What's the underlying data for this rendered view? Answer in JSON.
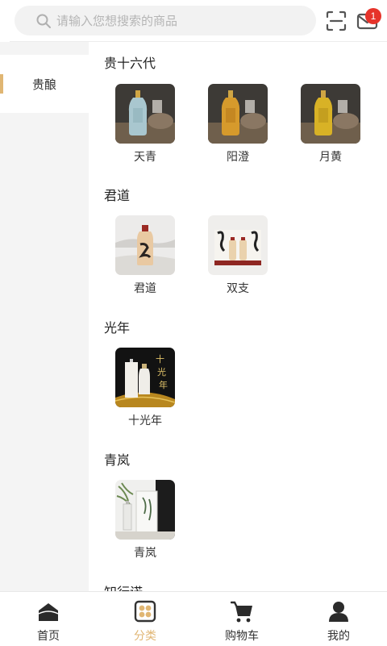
{
  "search": {
    "placeholder": "请输入您想搜索的商品"
  },
  "header": {
    "message_badge": "1"
  },
  "sidebar": {
    "items": [
      {
        "label": "贵酿",
        "active": true
      }
    ]
  },
  "sections": [
    {
      "title": "贵十六代",
      "products": [
        {
          "name": "天青"
        },
        {
          "name": "阳澄"
        },
        {
          "name": "月黄"
        }
      ]
    },
    {
      "title": "君道",
      "products": [
        {
          "name": "君道"
        },
        {
          "name": "双支"
        }
      ]
    },
    {
      "title": "光年",
      "products": [
        {
          "name": "十光年"
        }
      ]
    },
    {
      "title": "青岚",
      "products": [
        {
          "name": "青岚"
        }
      ]
    },
    {
      "title": "知行诺"
    }
  ],
  "tabbar": {
    "tabs": [
      {
        "label": "首页"
      },
      {
        "label": "分类",
        "active": true
      },
      {
        "label": "购物车"
      },
      {
        "label": "我的"
      }
    ]
  },
  "colors": {
    "accent": "#e0b673",
    "badge": "#e6332a",
    "sidebar_bg": "#f4f4f4"
  }
}
